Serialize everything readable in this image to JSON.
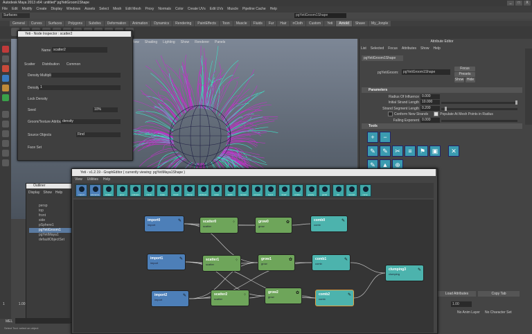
{
  "window": {
    "title": "Autodesk Maya 2013 x64: untitled*    pgYetiGroom1Shape",
    "buttons": [
      "_",
      "□",
      "X"
    ]
  },
  "menubar": [
    "File",
    "Edit",
    "Modify",
    "Create",
    "Display",
    "Windows",
    "Assets",
    "Select",
    "Mesh",
    "Edit Mesh",
    "Proxy",
    "Normals",
    "Color",
    "Create UVs",
    "Edit UVs",
    "Muscle",
    "Pipeline Cache",
    "Help"
  ],
  "status_line": {
    "mode": "Surfaces",
    "field": "pgYetiGroom1Shape"
  },
  "shelf_tabs": [
    {
      "label": "General",
      "active": false
    },
    {
      "label": "Curves",
      "active": false
    },
    {
      "label": "Surfaces",
      "active": false
    },
    {
      "label": "Polygons",
      "active": false
    },
    {
      "label": "Subdivs",
      "active": false
    },
    {
      "label": "Deformation",
      "active": false
    },
    {
      "label": "Animation",
      "active": false
    },
    {
      "label": "Dynamics",
      "active": false
    },
    {
      "label": "Rendering",
      "active": false
    },
    {
      "label": "PaintEffects",
      "active": false
    },
    {
      "label": "Toon",
      "active": false
    },
    {
      "label": "Muscle",
      "active": false
    },
    {
      "label": "Fluids",
      "active": false
    },
    {
      "label": "Fur",
      "active": false
    },
    {
      "label": "Hair",
      "active": false
    },
    {
      "label": "nCloth",
      "active": false
    },
    {
      "label": "Custom",
      "active": false
    },
    {
      "label": "Yeti",
      "active": false
    },
    {
      "label": "Arnold",
      "active": true
    },
    {
      "label": "Shave",
      "active": false
    },
    {
      "label": "My_Jonple",
      "active": false
    }
  ],
  "viewport": {
    "menu": [
      "View",
      "Shading",
      "Lighting",
      "Show",
      "Renderer",
      "Panels"
    ]
  },
  "attribute_editor": {
    "title": "Attribute Editor",
    "menu": [
      "List",
      "Selected",
      "Focus",
      "Attributes",
      "Show",
      "Help"
    ],
    "tab": "pgYetiGroom1Shape",
    "node_label": "pgYetiGroom:",
    "node_value": "pgYetiGroom1Shape",
    "buttons": [
      "Focus",
      "Presets",
      "Show",
      "Hide"
    ],
    "parameters_header": "Parameters",
    "params": [
      {
        "label": "Radius Of Influence",
        "value": "0.000",
        "knob": 0.0
      },
      {
        "label": "Initial Strand Length",
        "value": "10.000",
        "knob": 1.0
      },
      {
        "label": "Strand Segment Length",
        "value": "0.200",
        "knob": 0.05
      }
    ],
    "checkbox_1": "Conform New Strands",
    "checkbox_2": "Populate At Mesh Points in Radius",
    "falloff_label": "Falling Exponent",
    "falloff_value": "0.000",
    "tools_header": "Tools",
    "tool_icons": [
      "+",
      "−",
      "✎",
      "✎",
      "✂",
      "≡",
      "⚑",
      "▣",
      "✕",
      "✎",
      "▲",
      "⊕"
    ],
    "load_attributes": "Load Attributes",
    "copy_tab": "Copy Tab",
    "field_value": "1.00",
    "anim_layer": "No Anim Layer",
    "char_set": "No Character Set"
  },
  "node_inspector": {
    "title": "Yeti - Node Inspector : scatter2",
    "name_label": "Name",
    "name_value": "scatter2",
    "tabs": [
      "Scatter",
      "Distribution",
      "Common"
    ],
    "rows": {
      "density_multiplier": "Density Multiplier",
      "density": "Density",
      "density_value": "1",
      "lock_density": "Lock Density",
      "seed": "Seed",
      "seed_value": "10%",
      "groom_attr": "Groom/Texture Attribute",
      "groom_attr_value": "density",
      "source_objects": "Source Objects",
      "source_value": "Find",
      "face_set": "Face Set"
    }
  },
  "outliner": {
    "title": "Outliner",
    "menu": [
      "Display",
      "Show",
      "Help"
    ],
    "items": [
      {
        "label": "persp",
        "selected": false
      },
      {
        "label": "top",
        "selected": false
      },
      {
        "label": "front",
        "selected": false
      },
      {
        "label": "side",
        "selected": false
      },
      {
        "label": "pSphere1",
        "selected": false
      },
      {
        "label": "pgYetiGroom1",
        "selected": true
      },
      {
        "label": "pgYetiMaya1",
        "selected": false
      },
      {
        "label": "defaultObjectSet",
        "selected": false
      }
    ]
  },
  "graph_editor": {
    "title": "Yeti - v1.2.19 - GraphEditor ( currently viewing: pgYetiMaya1Shape )",
    "menu": [
      "View",
      "Utilities",
      "Help"
    ],
    "tools": [
      "import",
      "reference",
      "scatter",
      "grow",
      "collision",
      "comb",
      "scale",
      "block",
      "clump",
      "attribute",
      "noise",
      "width",
      "texture",
      "convert",
      "bend",
      "braid",
      "scatter",
      "gravity",
      "guide",
      "set",
      "texmid",
      "curve"
    ],
    "nodes": [
      {
        "id": "import0",
        "title": "import0",
        "sub": "import",
        "kind": "import"
      },
      {
        "id": "import1",
        "title": "import1",
        "sub": "import",
        "kind": "import"
      },
      {
        "id": "import2",
        "title": "import2",
        "sub": "import",
        "kind": "import"
      },
      {
        "id": "scatter0",
        "title": "scatter0",
        "sub": "scatter",
        "kind": "scatter"
      },
      {
        "id": "scatter1",
        "title": "scatter1",
        "sub": "scatter",
        "kind": "scatter"
      },
      {
        "id": "scatter2",
        "title": "scatter2",
        "sub": "scatter",
        "kind": "scatter"
      },
      {
        "id": "grow0",
        "title": "grow0",
        "sub": "grow",
        "kind": "grow"
      },
      {
        "id": "grow1",
        "title": "grow1",
        "sub": "grow",
        "kind": "grow"
      },
      {
        "id": "grow2",
        "title": "grow2",
        "sub": "grow",
        "kind": "grow"
      },
      {
        "id": "comb0",
        "title": "comb0",
        "sub": "comb",
        "kind": "comb"
      },
      {
        "id": "comb1",
        "title": "comb1",
        "sub": "comb",
        "kind": "comb"
      },
      {
        "id": "comb2",
        "title": "comb2",
        "sub": "comb",
        "kind": "comb"
      },
      {
        "id": "clumping3",
        "title": "clumping3",
        "sub": "clumping",
        "kind": "clump"
      }
    ]
  },
  "timeline": {
    "start": "1",
    "end": "1.00"
  },
  "command_line": {
    "label": "MEL",
    "help": "Select Tool: select an object"
  },
  "colors": {
    "import": "#4d7fb8",
    "scatter": "#6ea55a",
    "comb": "#4cb3ad",
    "hair_magenta": "#c032c8",
    "hair_cyan": "#3fe0c8",
    "tool_cyan": "#3b9bb0"
  }
}
